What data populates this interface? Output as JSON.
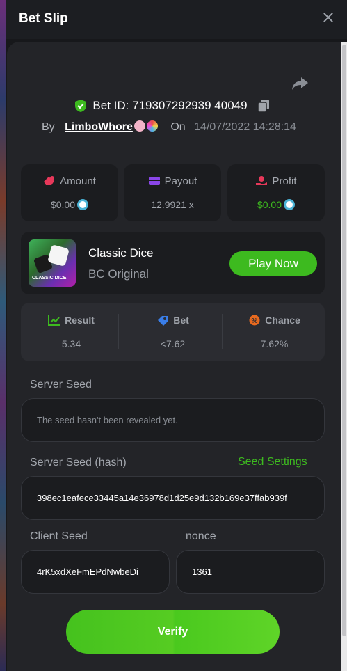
{
  "header": {
    "title": "Bet Slip"
  },
  "bet": {
    "id_text": "Bet ID: 719307292939 40049",
    "by_label": "By",
    "user": "LimboWhore",
    "on_label": "On",
    "date": "14/07/2022 14:28:14"
  },
  "stats": {
    "amount_label": "Amount",
    "amount_value": "$0.00",
    "payout_label": "Payout",
    "payout_value": "12.9921 x",
    "profit_label": "Profit",
    "profit_value": "$0.00"
  },
  "game": {
    "thumb_text": "CLASSIC DICE",
    "name": "Classic Dice",
    "subtitle": "BC Original",
    "play_label": "Play Now"
  },
  "result": {
    "result_label": "Result",
    "result_value": "5.34",
    "bet_label": "Bet",
    "bet_value": "<7.62",
    "chance_label": "Chance",
    "chance_value": "7.62%"
  },
  "seeds": {
    "server_seed_label": "Server Seed",
    "server_seed_value": "The seed hasn't been revealed yet.",
    "server_hash_label": "Server Seed (hash)",
    "seed_settings_label": "Seed Settings",
    "server_hash_value": "398ec1eafece33445a14e36978d1d25e9d132b169e37ffab939f",
    "client_seed_label": "Client Seed",
    "client_seed_value": "4rK5xdXeFmEPdNwbeDi",
    "nonce_label": "nonce",
    "nonce_value": "1361"
  },
  "verify_label": "Verify",
  "colors": {
    "accent": "#3dba1f",
    "panel": "#232428",
    "card": "#1b1c1f"
  },
  "icons": [
    "close-icon",
    "share-icon",
    "shield-check-icon",
    "copy-icon",
    "amount-icon",
    "payout-icon",
    "profit-icon",
    "result-icon",
    "bet-icon",
    "chance-icon",
    "coin-icon"
  ]
}
